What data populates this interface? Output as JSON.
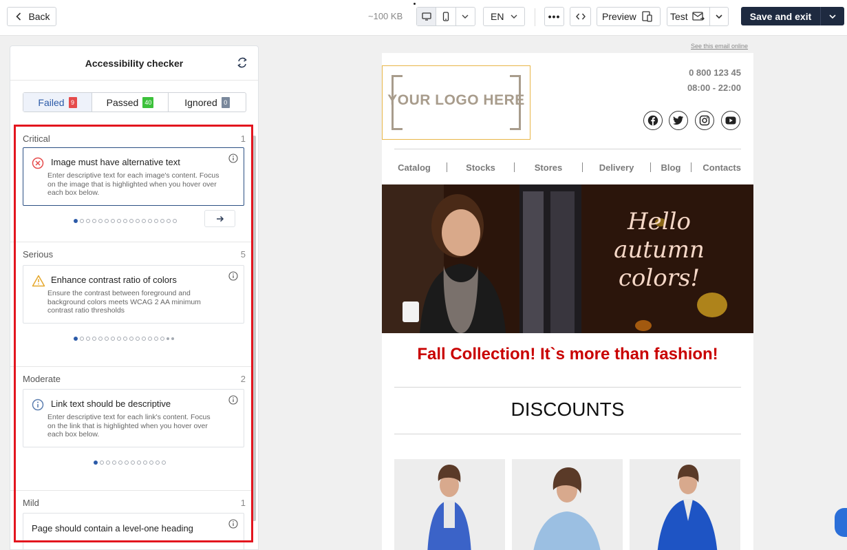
{
  "toolbar": {
    "back_label": "Back",
    "size_text": "~100 KB",
    "language": "EN",
    "more_label": "•••",
    "preview_label": "Preview",
    "test_label": "Test",
    "save_label": "Save and exit"
  },
  "panel": {
    "title": "Accessibility checker",
    "tabs": [
      {
        "label": "Failed",
        "count": "9",
        "color": "#e54b4b"
      },
      {
        "label": "Passed",
        "count": "40",
        "color": "#3cc13b"
      },
      {
        "label": "Ignored",
        "count": "0",
        "color": "#7a889c"
      }
    ],
    "sections": [
      {
        "name": "Critical",
        "count": "1",
        "issue_title": "Image must have alternative text",
        "issue_desc": "Enter descriptive text for each image's content. Focus on the image that is highlighted when you hover over each box below.",
        "icon": "error-circle-icon",
        "pages": 17
      },
      {
        "name": "Serious",
        "count": "5",
        "issue_title": "Enhance contrast ratio of colors",
        "issue_desc": "Ensure the contrast between foreground and background colors meets WCAG 2 AA minimum contrast ratio thresholds",
        "icon": "warning-icon",
        "pages": 17
      },
      {
        "name": "Moderate",
        "count": "2",
        "issue_title": "Link text should be descriptive",
        "issue_desc": "Enter descriptive text for each link's content. Focus on the link that is highlighted when you hover over each box below.",
        "icon": "info-circle-icon",
        "pages": 12
      },
      {
        "name": "Mild",
        "count": "1",
        "issue_title": "Page should contain a level-one heading"
      }
    ]
  },
  "email": {
    "online_link": "See this email online",
    "logo_text": "YOUR LOGO HERE",
    "phone": "0 800 123 45",
    "hours": "08:00 - 22:00",
    "nav": [
      "Catalog",
      "Stocks",
      "Stores",
      "Delivery",
      "Blog",
      "Contacts"
    ],
    "banner_text": "Hello autumn colors!",
    "headline": "Fall Collection! It`s more than fashion!",
    "section_title": "DISCOUNTS"
  },
  "colors": {
    "accent": "#2b5aa8",
    "save_button": "#1e2a40",
    "highlight": "#e3151e",
    "headline": "#c90000"
  }
}
